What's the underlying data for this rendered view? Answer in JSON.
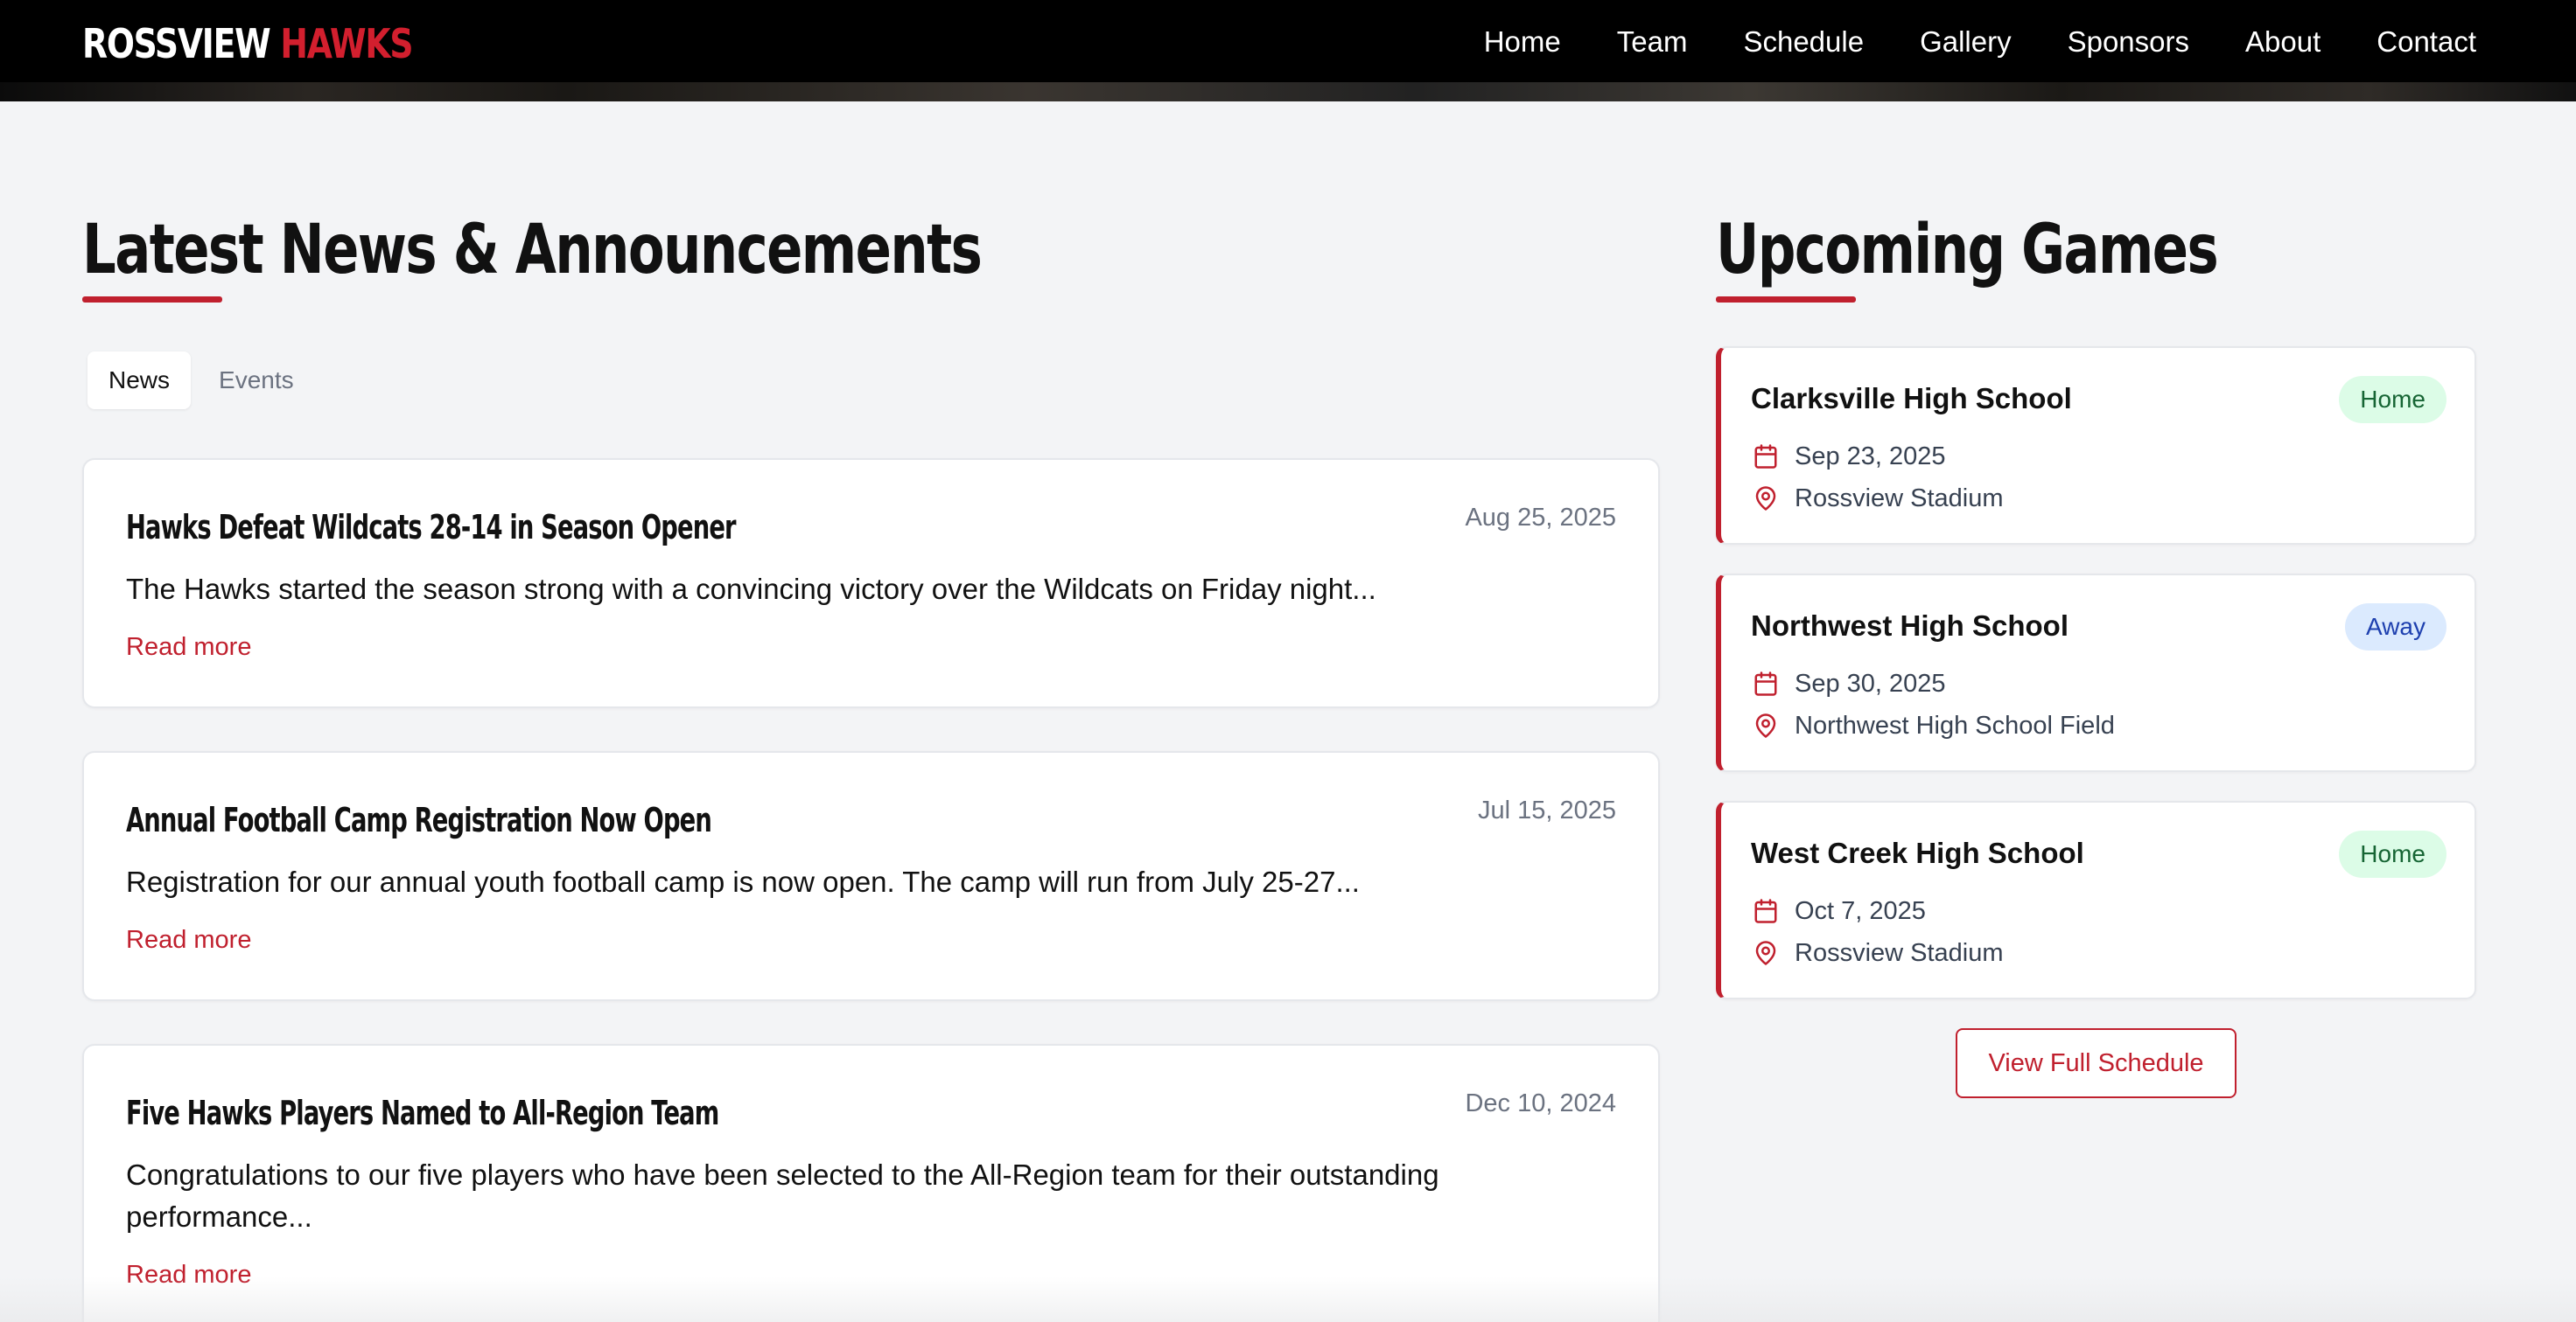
{
  "brand": {
    "part1": "ROSSVIEW",
    "part2": "HAWKS"
  },
  "nav": [
    "Home",
    "Team",
    "Schedule",
    "Gallery",
    "Sponsors",
    "About",
    "Contact"
  ],
  "news_section": {
    "title": "Latest News & Announcements",
    "tabs": [
      {
        "label": "News",
        "active": true
      },
      {
        "label": "Events",
        "active": false
      }
    ],
    "items": [
      {
        "title": "Hawks Defeat Wildcats 28-14 in Season Opener",
        "date": "Aug 25, 2025",
        "excerpt": "The Hawks started the season strong with a convincing victory over the Wildcats on Friday night...",
        "read_more": "Read more"
      },
      {
        "title": "Annual Football Camp Registration Now Open",
        "date": "Jul 15, 2025",
        "excerpt": "Registration for our annual youth football camp is now open. The camp will run from July 25-27...",
        "read_more": "Read more"
      },
      {
        "title": "Five Hawks Players Named to All-Region Team",
        "date": "Dec 10, 2024",
        "excerpt": "Congratulations to our five players who have been selected to the All-Region team for their outstanding performance...",
        "read_more": "Read more"
      }
    ]
  },
  "games_section": {
    "title": "Upcoming Games",
    "games": [
      {
        "opponent": "Clarksville High School",
        "badge": "Home",
        "date": "Sep 23, 2025",
        "location": "Rossview Stadium"
      },
      {
        "opponent": "Northwest High School",
        "badge": "Away",
        "date": "Sep 30, 2025",
        "location": "Northwest High School Field"
      },
      {
        "opponent": "West Creek High School",
        "badge": "Home",
        "date": "Oct 7, 2025",
        "location": "Rossview Stadium"
      }
    ],
    "schedule_button": "View Full Schedule"
  },
  "colors": {
    "accent": "#c0202e",
    "home_badge_bg": "#dcfce7",
    "away_badge_bg": "#dbeafe",
    "page_bg": "#f3f4f6"
  },
  "icons": {
    "date": "calendar-icon",
    "location": "map-pin-icon"
  }
}
